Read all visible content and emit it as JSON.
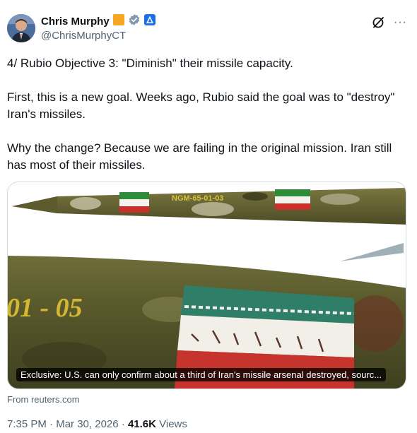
{
  "author": {
    "display_name": "Chris Murphy",
    "handle": "@ChrisMurphyCT",
    "avatar_icon": "profile-photo",
    "badges": [
      "orange-square-icon",
      "verified-government-icon",
      "senate-icon"
    ]
  },
  "actions": {
    "grok_icon": "grok-slash-circle-icon",
    "more_icon": "more-options-icon",
    "more_label": "···"
  },
  "tweet": {
    "paragraphs": [
      "4/ Rubio Objective 3: \"Diminish\" their missile capacity.",
      "First, this is a new goal. Weeks ago, Rubio said the goal was to \"destroy\" Iran's missiles.",
      "Why the change? Because we are failing in the original mission. Iran still has most of their missiles."
    ]
  },
  "card": {
    "image_description_icon": "missile-photo",
    "missile_top_marking": "NGM-65-01-03",
    "missile_bottom_marking": "01 - 05",
    "caption": "Exclusive: U.S. can only confirm about a third of Iran's missile arsenal destroyed, sourc...",
    "source": "From reuters.com"
  },
  "meta": {
    "time": "7:35 PM",
    "separator": " · ",
    "date": "Mar 30, 2026",
    "views_count": "41.6K",
    "views_label": " Views"
  },
  "colors": {
    "text_primary": "#0f1419",
    "text_secondary": "#536471",
    "border": "#cfd9de",
    "verified_gray": "#829aab",
    "senate_blue": "#1d6fe8",
    "orange_badge": "#f5a623"
  }
}
